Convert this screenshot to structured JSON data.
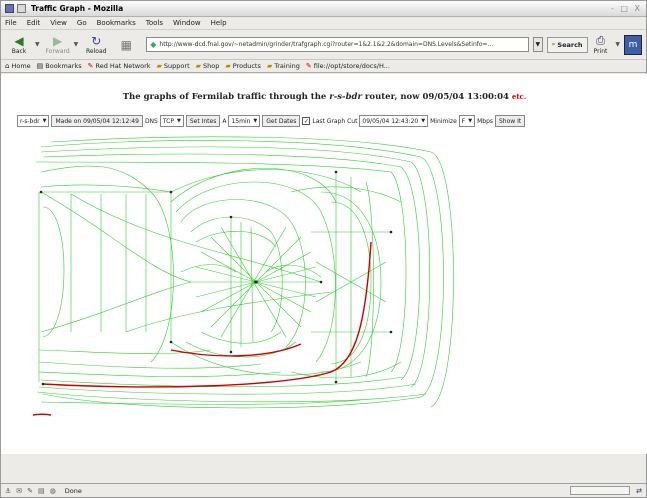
{
  "window": {
    "title": "Traffic Graph - Mozilla",
    "controls": "- □ X"
  },
  "menu": [
    "File",
    "Edit",
    "View",
    "Go",
    "Bookmarks",
    "Tools",
    "Window",
    "Help"
  ],
  "nav": {
    "back_label": "Back",
    "forward_label": "Forward",
    "reload_label": "Reload",
    "url": "http://www-dcd.fnal.gov/~netadmin/grinder/trafgraph.cgi?router=1&2.1&2.2&domain=DNS.Levels&Setinfo=...",
    "search_label": "Search",
    "print_label": "Print"
  },
  "bookmarks": [
    "Home",
    "Bookmarks",
    "Red Hat Network",
    "Support",
    "Shop",
    "Products",
    "Training",
    "file://opt/store/docs/H..."
  ],
  "page": {
    "heading_prefix": "The graphs of Fermilab traffic through the",
    "router_name": "r-s-bdr",
    "heading_suffix": "router, now 09/05/04 13:00:04",
    "etc_link": "etc."
  },
  "controls": {
    "router_select": "r-s-bdr",
    "made_on": "Made on 09/05/04 12:12:49",
    "dns_label": "DNS",
    "proto_select": "TCP",
    "set_intes": "Set Intes",
    "a_label": "A",
    "interval_select": "15min",
    "get_dates": "Get Dates",
    "last_graph_label": "Last Graph Cut",
    "date_select": "09/05/04 12:43:20",
    "minimize_label": "Minimize",
    "minimize_select": "F",
    "mbps_label": "Mbps",
    "show_it": "Show It"
  },
  "status": {
    "text": "Done"
  },
  "colors": {
    "edge_green": "#33cc33",
    "edge_red": "#cc0000",
    "link_red": "#cc0000"
  }
}
